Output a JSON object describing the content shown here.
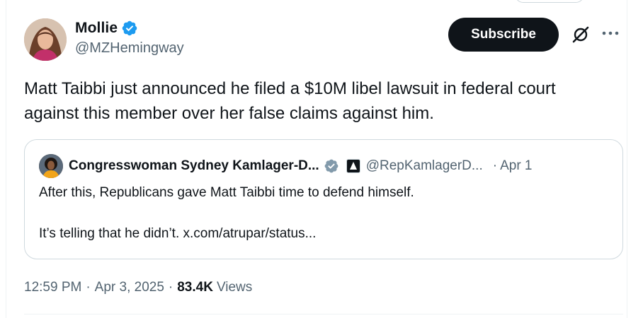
{
  "tweet": {
    "author": {
      "display_name": "Mollie",
      "handle": "@MZHemingway",
      "verified": true,
      "avatar_icon": "avatar-photo"
    },
    "actions": {
      "subscribe_label": "Subscribe",
      "grok_icon": "grok-icon",
      "more_icon": "more-icon"
    },
    "text_line1": "Matt Taibbi just announced he filed a $10M libel lawsuit in federal court",
    "text_line2": "against this member over her false claims against him.",
    "quote": {
      "display_name": "Congresswoman Sydney Kamlager-D...",
      "handle": "@RepKamlagerD...",
      "separator": "·",
      "date": "Apr 1",
      "verified_color": "#829aab",
      "line1": "After this, Republicans gave Matt Taibbi time to defend himself.",
      "line2": "It’s telling that he didn’t. x.com/atrupar/status..."
    },
    "meta": {
      "time": "12:59 PM",
      "dot1": "·",
      "date": "Apr 3, 2025",
      "dot2": "·",
      "views_count": "83.4K",
      "views_label": "Views"
    }
  },
  "colors": {
    "text_primary": "#0f1419",
    "text_secondary": "#536471",
    "verified_blue": "#1d9bf0",
    "border": "#cfd9de",
    "button_bg": "#0f1419"
  }
}
